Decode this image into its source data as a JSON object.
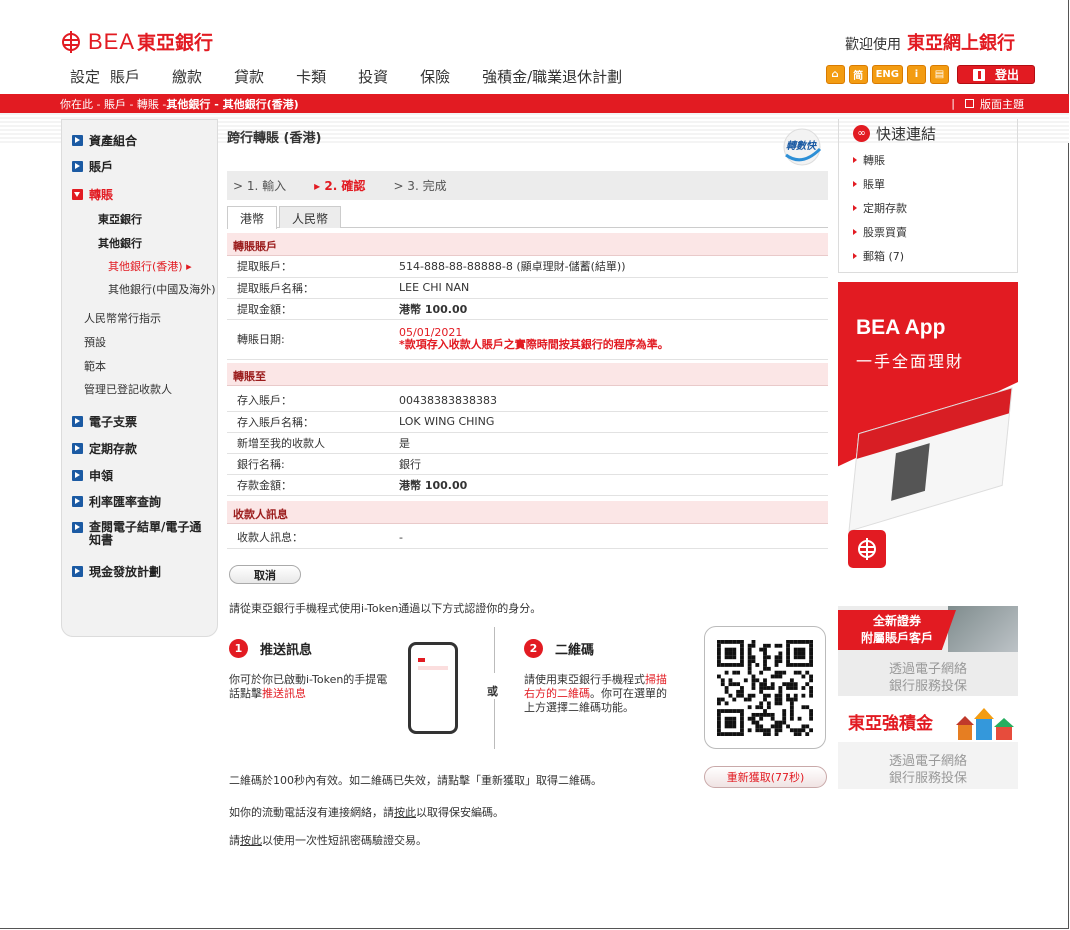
{
  "header": {
    "brand_latin": "BEA",
    "brand_cn": "東亞銀行",
    "welcome_prefix": "歡迎使用",
    "welcome_service": "東亞網上銀行"
  },
  "topnav": [
    "設定",
    "賬戶",
    "繳款",
    "貸款",
    "卡類",
    "投資",
    "保險",
    "強積金/職業退休計劃"
  ],
  "utility": {
    "home": "⌂",
    "simplified": "简",
    "english": "ENG",
    "info": "i",
    "mail": "▤",
    "logout": "登出"
  },
  "breadcrumb": {
    "prefix": "你在此 - 賬戶 - 轉賬 - ",
    "current": "其他銀行 - 其他銀行(香港)",
    "theme_sep": "|",
    "theme": "版面主題"
  },
  "sidebar": {
    "portfolio": "資產組合",
    "accounts": "賬戶",
    "transfer": "轉賬",
    "bea": "東亞銀行",
    "other_banks": "其他銀行",
    "other_hk": "其他銀行(香港) ▸",
    "other_cn": "其他銀行(中國及海外)",
    "rmb_standing": "人民幣常行指示",
    "preset": "預設",
    "template": "範本",
    "manage_payee": "管理已登記收款人",
    "echeque": "電子支票",
    "deposit": "定期存款",
    "apply": "申領",
    "rates": "利率匯率查詢",
    "estatement": "查閱電子結單/電子通知書",
    "cash_plan": "現金發放計劃"
  },
  "main": {
    "title": "跨行轉賬 (香港)",
    "badge": "轉數快",
    "steps": [
      "> 1. 輸入",
      "▸ 2. 確認",
      "> 3. 完成"
    ],
    "tabs": [
      "港幣",
      "人民幣"
    ],
    "section_from": "轉賬賬戶",
    "from_rows": [
      {
        "label": "提取賬戶：",
        "value": "514-888-88-88888-8 (顯卓理財-儲蓄(結單))"
      },
      {
        "label": "提取賬戶名稱：",
        "value": "LEE CHI NAN"
      },
      {
        "label": "提取金額：",
        "value": "港幣 100.00"
      }
    ],
    "date_label": "轉賬日期:",
    "date_value": "05/01/2021",
    "date_note": "*款項存入收款人賬戶之實際時間按其銀行的程序為準。",
    "section_to": "轉賬至",
    "to_rows": [
      {
        "label": "存入賬戶：",
        "value": "00438383838383"
      },
      {
        "label": "存入賬戶名稱：",
        "value": "LOK WING CHING"
      },
      {
        "label": "新增至我的收款人",
        "value": "是"
      },
      {
        "label": "銀行名稱:",
        "value": "銀行"
      },
      {
        "label": "存款金額：",
        "value": "港幣 100.00"
      }
    ],
    "section_msg": "收款人訊息",
    "msg_rows": [
      {
        "label": "收款人訊息：",
        "value": "-"
      }
    ],
    "cancel": "取消",
    "auth_intro": "請從東亞銀行手機程式使用i-Token通過以下方式認證你的身分。",
    "method1_num": "1",
    "method1_title": "推送訊息",
    "method1_desc_a": "你可於你已啟動i-Token的手提電話點擊",
    "method1_desc_link": "推送訊息",
    "or": "或",
    "method2_num": "2",
    "method2_title": "二維碼",
    "method2_desc_a": "請使用東亞銀行手機程式",
    "method2_desc_link": "掃描右方的二維碼",
    "method2_desc_b": "。你可在選單的上方選擇二維碼功能。",
    "qr_note": "二維碼於100秒內有效。如二維碼已失效，請點擊「重新獲取」取得二維碼。",
    "refresh": "重新獲取(77秒)",
    "foot1_a": "如你的流動電話沒有連接網絡，請",
    "foot1_link": "按此",
    "foot1_b": "以取得保安編碼。",
    "foot2_a": "請",
    "foot2_link": "按此",
    "foot2_b": "以使用一次性短訊密碼驗證交易。"
  },
  "quick": {
    "title": "快速連結",
    "items": [
      "轉賬",
      "賬單",
      "定期存款",
      "股票買賣",
      "郵箱 (7)"
    ]
  },
  "promo_app": {
    "title": "BEA App",
    "subtitle": "一手全面理財"
  },
  "promo_sec": {
    "line1": "全新證券",
    "line2": "附屬賬戶客戶",
    "g1": "透過電子網絡",
    "g2": "銀行服務投保"
  },
  "promo_mpf": {
    "title": "東亞強積金",
    "g1": "透過電子網絡",
    "g2": "銀行服務投保"
  },
  "colors": {
    "brand_red": "#e21b22",
    "nav_blue": "#1b5aa3",
    "section_pink": "#fbe6e6"
  }
}
